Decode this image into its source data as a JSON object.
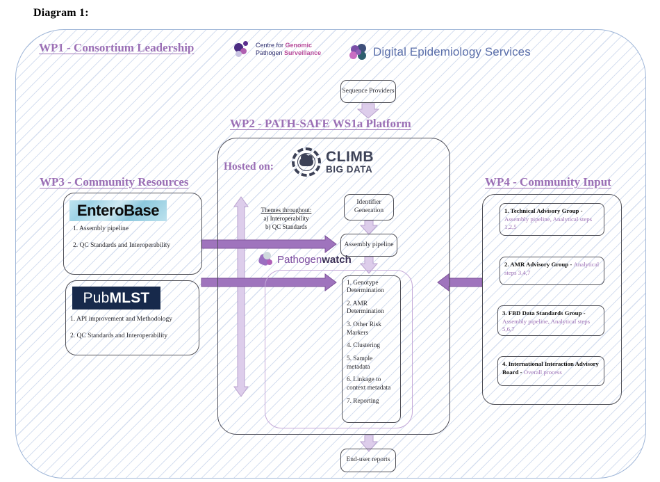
{
  "page": {
    "title": "Diagram 1:"
  },
  "work_packages": {
    "wp1": "WP1 - Consortium Leadership",
    "wp2": "WP2 - PATH-SAFE WS1a Platform",
    "wp3": "WP3 - Community Resources",
    "wp4": "WP4 - Community Input"
  },
  "logos": {
    "cgps_line1_plain": "Centre for ",
    "cgps_line1_bold": "Genomic",
    "cgps_line2_plain": "Pathogen ",
    "cgps_line2_bold": "Surveillance",
    "des": "Digital Epidemiology Services",
    "climb_line1": "CLIMB",
    "climb_line2": "BIG DATA",
    "pathogenwatch_plain": "Pathogen",
    "pathogenwatch_bold": "watch",
    "enterobase": "EnteroBase",
    "pubmlst_plain": "Pub",
    "pubmlst_bold": "MLST"
  },
  "platform": {
    "hosted_on_label": "Hosted on:",
    "sequence_providers": "Sequence Providers",
    "identifier_generation": "Identifier Generation",
    "assembly_pipeline": "Assembly pipeline",
    "end_user_reports": "End-user reports",
    "themes_heading": "Themes throughout:",
    "themes_a": "a) Interoperability",
    "themes_b": "b) QC Standards",
    "steps": [
      "1. Genotype Determination",
      "2. AMR Determination",
      "3. Other Risk Markers",
      "4. Clustering",
      "5. Sample metadata",
      "6. Linkage to context metadata",
      "7. Reporting"
    ]
  },
  "community_resources": [
    {
      "logo": "EnteroBase",
      "items": [
        "1. Assembly pipeline",
        "2. QC Standards and Interoperability"
      ]
    },
    {
      "logo": "PubMLST",
      "items": [
        "1. API improvement and Methodology",
        "2. QC  Standards and Interoperability"
      ]
    }
  ],
  "community_input": [
    {
      "title": "1. Technical Advisory Group - ",
      "detail": "Assembly pipeline, Analytical steps 1,2,5"
    },
    {
      "title": "2. AMR Advisory Group - ",
      "detail": "Analytical steps 3,4,7"
    },
    {
      "title": "3. FBD Data Standards Group - ",
      "detail": "Assembly pipeline, Analytical steps 5,6,7"
    },
    {
      "title": "4. International Interaction Advisory Board - ",
      "detail": "Overall process"
    }
  ],
  "colors": {
    "heading_purple": "#9b6fb5",
    "arrow_light_purple": "#d6c3e6",
    "arrow_dark_purple": "#9b6bb5",
    "frame_blue": "#9fb6d8",
    "node_border": "#4f4f56"
  }
}
